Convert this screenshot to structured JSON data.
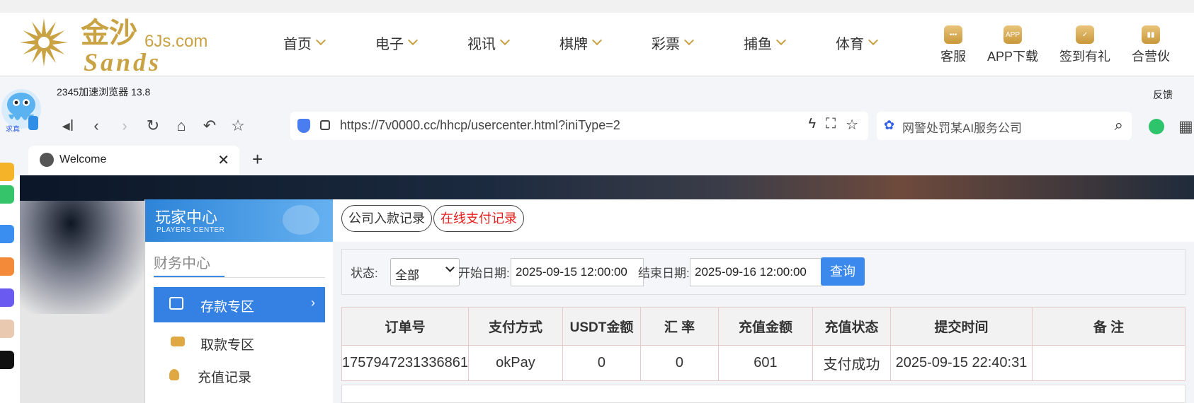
{
  "site": {
    "logo_text": "金沙",
    "logo_domain": "6Js.com",
    "logo_sub": "Sands",
    "nav": [
      "首页",
      "电子",
      "视讯",
      "棋牌",
      "彩票",
      "捕鱼",
      "体育"
    ],
    "header_right": [
      {
        "label": "客服",
        "icon": "chat-icon"
      },
      {
        "label": "APP下载",
        "icon": "app-icon"
      },
      {
        "label": "签到有礼",
        "icon": "gift-icon"
      },
      {
        "label": "合营伙",
        "icon": "partner-icon"
      }
    ]
  },
  "browser": {
    "name": "2345加速浏览器 13.8",
    "feedback": "反馈",
    "url": "https://7v0000.cc/hhcp/usercenter.html?iniType=2",
    "search_text": "网警处罚某AI服务公司",
    "tab_title": "Welcome",
    "close_glyph": "✕",
    "newtab_glyph": "+",
    "mascot_label": "求真"
  },
  "sidebar": {
    "title": "玩家中心",
    "subtitle": "PLAYERS CENTER",
    "section": "财务中心",
    "items": [
      {
        "label": "存款专区",
        "active": true
      },
      {
        "label": "取款专区",
        "active": false
      },
      {
        "label": "充值记录",
        "active": false
      }
    ]
  },
  "main": {
    "tabs": [
      "公司入款记录",
      "在线支付记录"
    ],
    "active_tab_color": "#e52020",
    "filter": {
      "status_label": "状态:",
      "status_value": "全部",
      "start_label": "开始日期:",
      "start_value": "2025-09-15 12:00:00",
      "end_label": "结束日期:",
      "end_value": "2025-09-16 12:00:00",
      "query_button": "查询"
    },
    "table": {
      "headers": [
        "订单号",
        "支付方式",
        "USDT金额",
        "汇 率",
        "充值金额",
        "充值状态",
        "提交时间",
        "备 注"
      ],
      "rows": [
        [
          "1757947231336861",
          "okPay",
          "0",
          "0",
          "601",
          "支付成功",
          "2025-09-15 22:40:31",
          ""
        ]
      ]
    }
  }
}
